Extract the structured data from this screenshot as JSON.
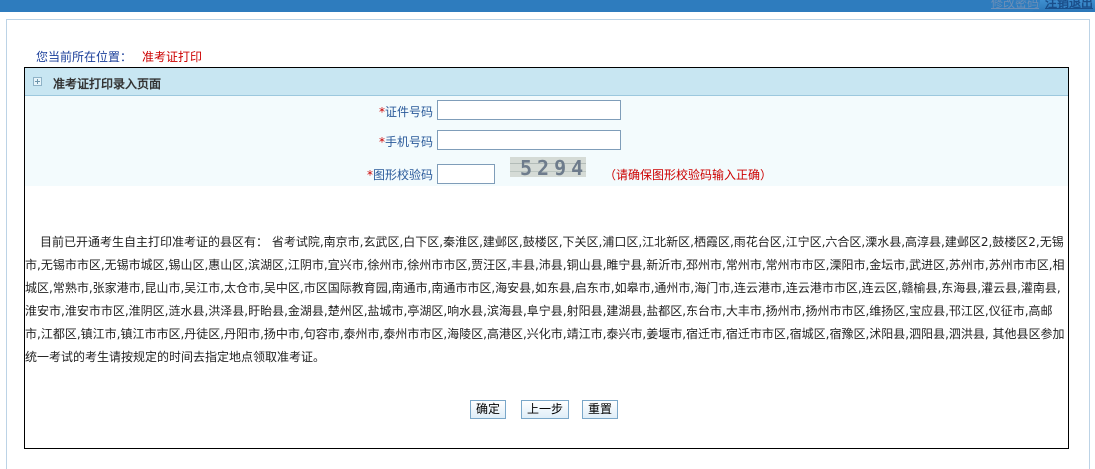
{
  "header": {
    "change_password": "修改密码",
    "logout": "注销退出"
  },
  "breadcrumb": {
    "label": "您当前所在位置：",
    "current": "准考证打印"
  },
  "panel": {
    "title": "准考证打印录入页面"
  },
  "form": {
    "required_mark": "*",
    "id_label": "证件号码",
    "id_value": "",
    "phone_label": "手机号码",
    "phone_value": "",
    "captcha_label": "图形校验码",
    "captcha_value": "",
    "captcha_text": "5294",
    "captcha_hint": "（请确保图形校验码输入正确）"
  },
  "notice": "目前已开通考生自主打印准考证的县区有： 省考试院,南京市,玄武区,白下区,秦淮区,建邺区,鼓楼区,下关区,浦口区,江北新区,栖霞区,雨花台区,江宁区,六合区,溧水县,高淳县,建邺区2,鼓楼区2,无锡市,无锡市市区,无锡市城区,锡山区,惠山区,滨湖区,江阴市,宜兴市,徐州市,徐州市市区,贾汪区,丰县,沛县,铜山县,睢宁县,新沂市,邳州市,常州市,常州市市区,溧阳市,金坛市,武进区,苏州市,苏州市市区,相城区,常熟市,张家港市,昆山市,吴江市,太仓市,吴中区,市区国际教育园,南通市,南通市市区,海安县,如东县,启东市,如皋市,通州市,海门市,连云港市,连云港市市区,连云区,赣榆县,东海县,灌云县,灌南县,淮安市,淮安市市区,淮阴区,涟水县,洪泽县,盱眙县,金湖县,楚州区,盐城市,亭湖区,响水县,滨海县,阜宁县,射阳县,建湖县,盐都区,东台市,大丰市,扬州市,扬州市市区,维扬区,宝应县,邗江区,仪征市,高邮市,江都区,镇江市,镇江市市区,丹徒区,丹阳市,扬中市,句容市,泰州市,泰州市市区,海陵区,高港区,兴化市,靖江市,泰兴市,姜堰市,宿迁市,宿迁市市区,宿城区,宿豫区,沭阳县,泗阳县,泗洪县, 其他县区参加统一考试的考生请按规定的时间去指定地点领取准考证。",
  "buttons": {
    "confirm": "确定",
    "prev": "上一步",
    "reset": "重置"
  }
}
